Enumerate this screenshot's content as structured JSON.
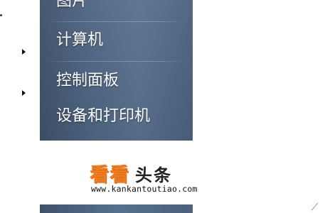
{
  "start_menu": {
    "items": [
      {
        "label": "图片"
      },
      {
        "label": "计算机"
      },
      {
        "label": "控制面板"
      },
      {
        "label": "设备和打印机"
      }
    ]
  },
  "watermark": {
    "brand": "看看",
    "suffix": "头条",
    "url": "www.kankantoutiao.com"
  },
  "colors": {
    "menu_background": "#4f6784",
    "menu_text": "#ffffff",
    "watermark_orange": "#f07b1e"
  },
  "icons": [
    "submenu-arrow-icon",
    "submenu-arrow-icon"
  ]
}
